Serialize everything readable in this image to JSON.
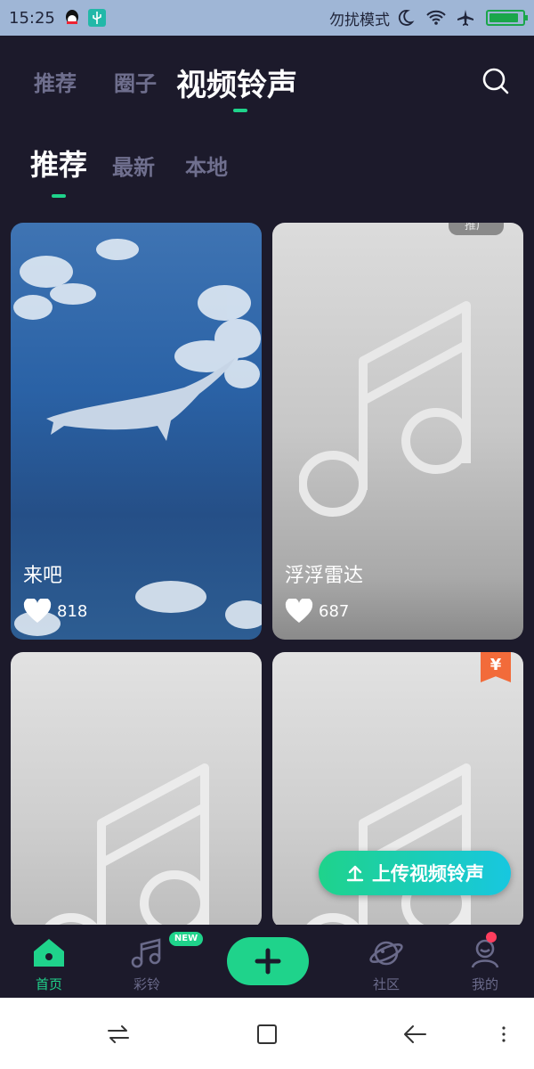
{
  "status_bar": {
    "time": "15:25",
    "dnd_label": "勿扰模式",
    "battery_level": 0.9
  },
  "top_nav": {
    "tabs": [
      {
        "label": "推荐"
      },
      {
        "label": "圈子"
      },
      {
        "label": "视频铃声"
      }
    ],
    "active": "视频铃声"
  },
  "sub_nav": {
    "tabs": [
      {
        "label": "推荐"
      },
      {
        "label": "最新"
      },
      {
        "label": "本地"
      }
    ],
    "active": "推荐"
  },
  "cards": [
    {
      "title": "来吧",
      "likes": "818"
    },
    {
      "title": "浮浮雷达",
      "likes": "687",
      "tag": "推广"
    },
    {
      "title": "",
      "likes": ""
    },
    {
      "title": "",
      "likes": "",
      "badge": "¥"
    }
  ],
  "upload_button": {
    "label": "上传视频铃声"
  },
  "bottom_nav": {
    "items": [
      {
        "label": "首页"
      },
      {
        "label": "彩铃"
      },
      {
        "label": "社区"
      },
      {
        "label": "我的"
      }
    ],
    "new_badge": "NEW"
  },
  "colors": {
    "accent": "#1fd38b",
    "background": "#1c1a2b",
    "inactive": "#6f6f8e",
    "status_bar": "#9fb6d6",
    "notify_dot": "#ff3e5e",
    "yen_badge": "#f26b3a"
  }
}
